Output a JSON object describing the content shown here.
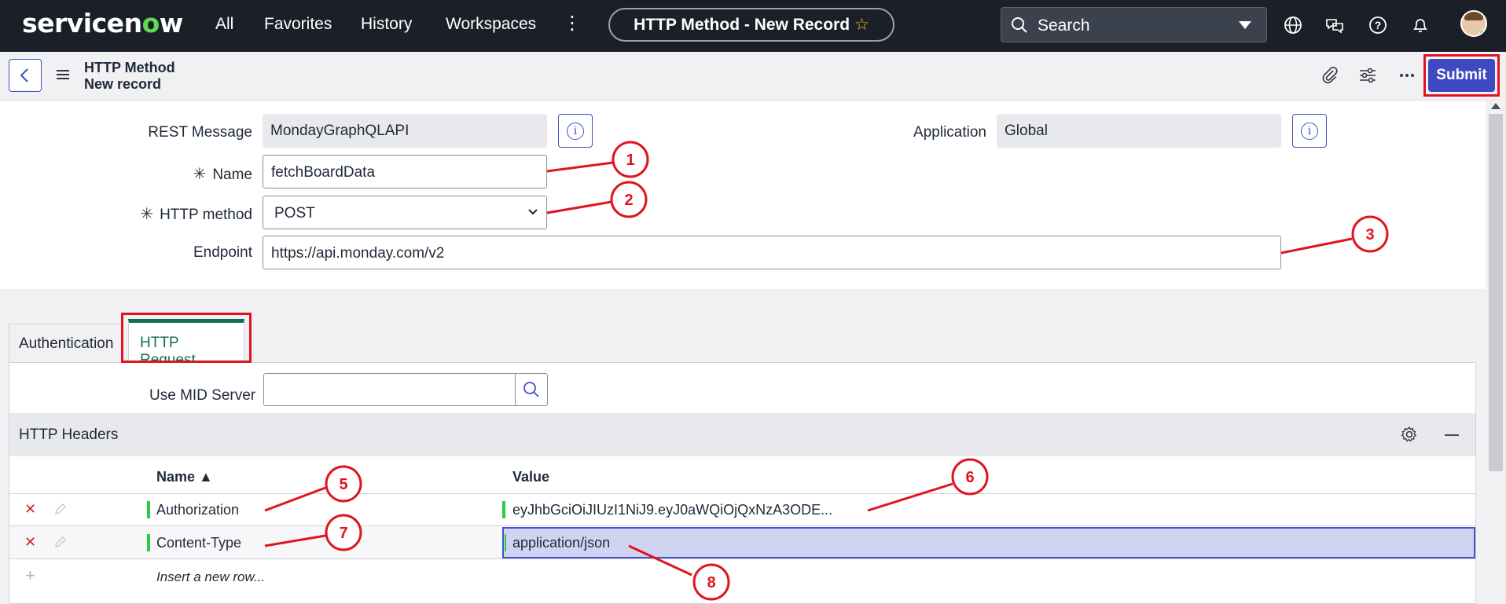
{
  "topnav": {
    "logo_pre": "servicen",
    "logo_o": "o",
    "logo_post": "w",
    "links": [
      "All",
      "Favorites",
      "History",
      "Workspaces"
    ],
    "more": "⋮",
    "record_title": "HTTP Method - New Record",
    "favorite_icon": "star-icon",
    "search_placeholder": "Search",
    "icons": [
      "globe-icon",
      "chat-icon",
      "help-icon",
      "bell-icon"
    ]
  },
  "subheader": {
    "title": "HTTP Method",
    "subtitle": "New record",
    "submit_label": "Submit",
    "icons": [
      "paperclip-icon",
      "sliders-icon",
      "more-icon"
    ]
  },
  "form": {
    "rest_message": {
      "label": "REST Message",
      "value": "MondayGraphQLAPI"
    },
    "application": {
      "label": "Application",
      "value": "Global"
    },
    "name": {
      "label": "Name",
      "required": "✳",
      "value": "fetchBoardData"
    },
    "http_method": {
      "label": "HTTP method",
      "required": "✳",
      "value": "POST"
    },
    "endpoint": {
      "label": "Endpoint",
      "value": "https://api.monday.com/v2"
    }
  },
  "tabs": [
    {
      "label": "Authentication",
      "active": false
    },
    {
      "label": "HTTP Request",
      "active": true
    }
  ],
  "http_request": {
    "mid_server_label": "Use MID Server",
    "mid_server_value": "",
    "headers_section_title": "HTTP Headers",
    "columns": [
      "Name ▲",
      "Value"
    ],
    "rows": [
      {
        "name": "Authorization",
        "value": "eyJhbGciOiJIUzI1NiJ9.eyJ0aWQiOjQxNzA3ODE..."
      },
      {
        "name": "Content-Type",
        "value": "application/json"
      }
    ],
    "insert_row": "Insert a new row..."
  },
  "annotations": [
    "1",
    "2",
    "3",
    "5",
    "6",
    "7",
    "8"
  ],
  "colors": {
    "annotation_red": "#e0141e",
    "primary_button": "#3f4ac2",
    "active_tab": "#0f6e56",
    "nav_bg": "#1b2028"
  }
}
